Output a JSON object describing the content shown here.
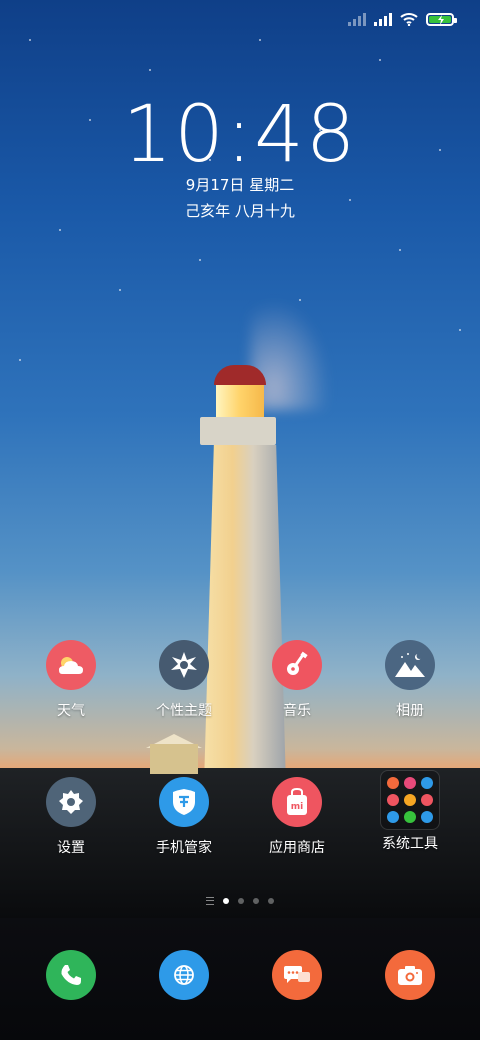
{
  "status_bar": {
    "signal1_icon": "signal-weak-icon",
    "signal2_icon": "signal-full-icon",
    "wifi_icon": "wifi-icon",
    "battery_icon": "battery-charging-icon",
    "battery_color": "#37c23c"
  },
  "lockscreen": {
    "time": "10:48",
    "date": "9月17日 星期二",
    "lunar": "己亥年 八月十九"
  },
  "apps_row1": [
    {
      "label": "天气",
      "icon": "weather-icon",
      "color": "#ee5b64"
    },
    {
      "label": "个性主题",
      "icon": "theme-icon",
      "color": "#465a70"
    },
    {
      "label": "音乐",
      "icon": "music-icon",
      "color": "#ef5560"
    },
    {
      "label": "相册",
      "icon": "gallery-icon",
      "color": "#4b6682"
    }
  ],
  "apps_row2": [
    {
      "label": "设置",
      "icon": "settings-icon",
      "color": "#4f6478"
    },
    {
      "label": "手机管家",
      "icon": "security-icon",
      "color": "#2e9ae8"
    },
    {
      "label": "应用商店",
      "icon": "app-store-icon",
      "color": "#ef5560"
    },
    {
      "label": "系统工具",
      "icon": "system-tools-folder-icon",
      "color": "#000000"
    }
  ],
  "pager": {
    "pages": 4,
    "active": 1
  },
  "dock": [
    {
      "name": "phone",
      "icon": "phone-icon",
      "color": "#2fb55a"
    },
    {
      "name": "browser",
      "icon": "globe-icon",
      "color": "#2e9ae8"
    },
    {
      "name": "messages",
      "icon": "messages-icon",
      "color": "#f36a3c"
    },
    {
      "name": "camera",
      "icon": "camera-icon",
      "color": "#f36a3c"
    }
  ]
}
